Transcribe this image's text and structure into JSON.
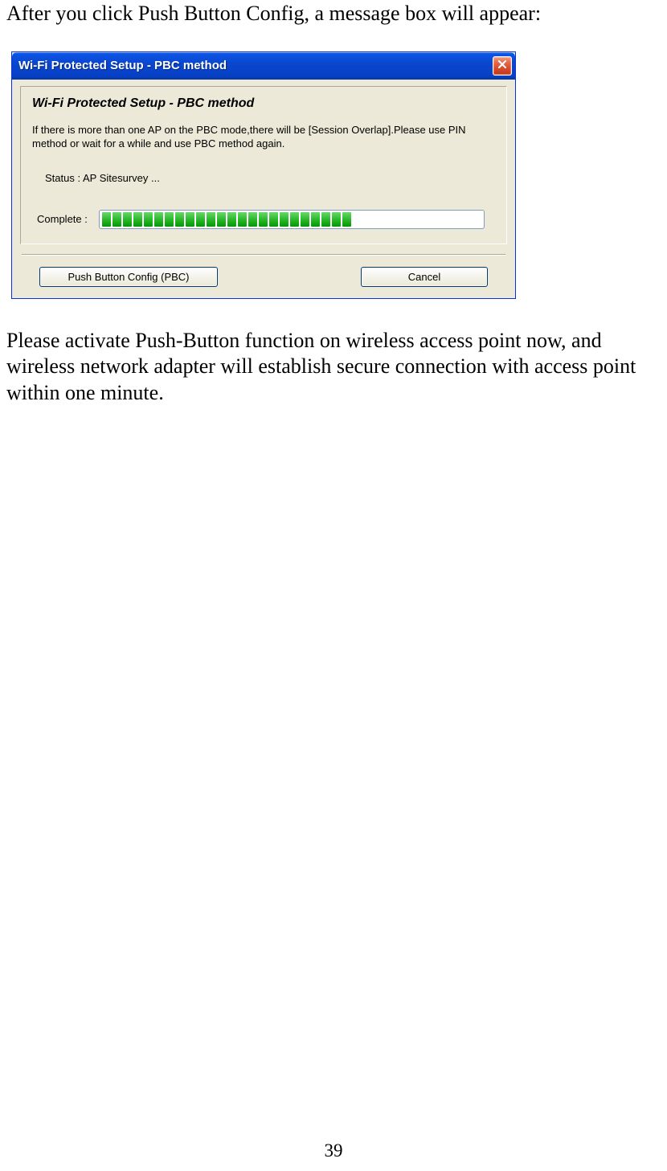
{
  "page": {
    "intro": "After you click Push Button Config, a message box will appear:",
    "outro": "Please activate Push-Button function on wireless access point now, and wireless network adapter will establish secure connection with access point within one minute.",
    "number": "39"
  },
  "dialog": {
    "title": "Wi-Fi Protected Setup - PBC method",
    "panel_title": "Wi-Fi Protected Setup - PBC method",
    "description": "If there is more than one AP on the PBC mode,there will be [Session Overlap].Please use PIN method or wait for a while and use PBC method again.",
    "status_label": "Status : AP Sitesurvey ...",
    "complete_label": "Complete :",
    "progress_segments_filled": 24,
    "progress_segments_total": 36,
    "buttons": {
      "pbc": "Push Button Config (PBC)",
      "cancel": "Cancel"
    }
  }
}
